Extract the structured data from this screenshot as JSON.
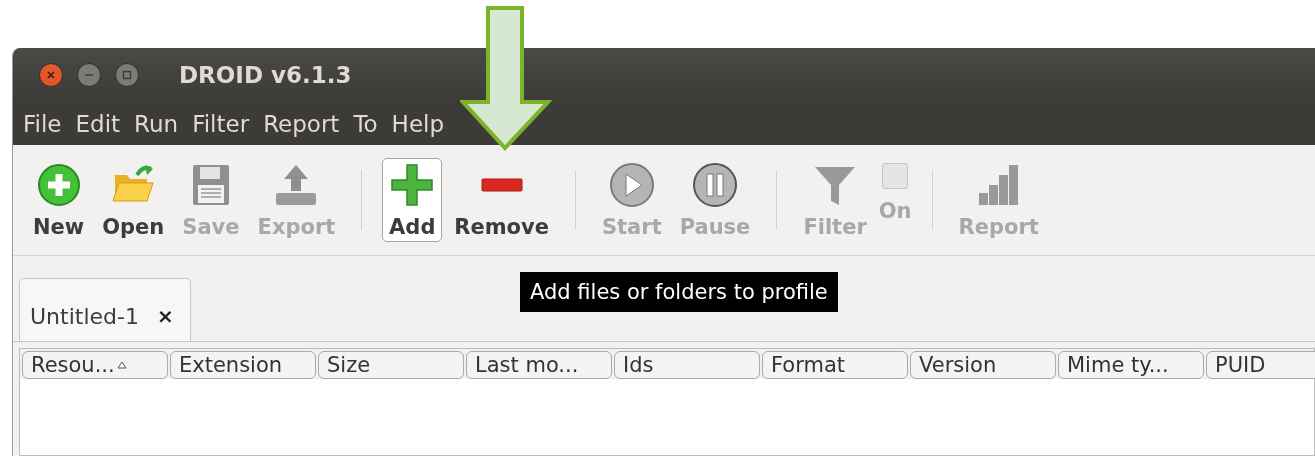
{
  "window": {
    "title": "DROID v6.1.3"
  },
  "menu": [
    {
      "label": "File"
    },
    {
      "label": "Edit"
    },
    {
      "label": "Run"
    },
    {
      "label": "Filter"
    },
    {
      "label": "Report"
    },
    {
      "label": "To"
    },
    {
      "label": "Help"
    }
  ],
  "toolbar": [
    {
      "kind": "button",
      "label": "New",
      "disabled": false,
      "hovered": false
    },
    {
      "kind": "button",
      "label": "Open",
      "disabled": false,
      "hovered": false
    },
    {
      "kind": "button",
      "label": "Save",
      "disabled": true,
      "hovered": false
    },
    {
      "kind": "button",
      "label": "Export",
      "disabled": true,
      "hovered": false
    },
    {
      "kind": "separator"
    },
    {
      "kind": "button",
      "label": "Add",
      "disabled": false,
      "hovered": true
    },
    {
      "kind": "button",
      "label": "Remove",
      "disabled": false,
      "hovered": false
    },
    {
      "kind": "separator"
    },
    {
      "kind": "button",
      "label": "Start",
      "disabled": true,
      "hovered": false
    },
    {
      "kind": "button",
      "label": "Pause",
      "disabled": true,
      "hovered": false
    },
    {
      "kind": "separator"
    },
    {
      "kind": "button",
      "label": "Filter",
      "disabled": true,
      "hovered": false
    },
    {
      "kind": "toggle",
      "label": "On",
      "disabled": true,
      "checked": false
    },
    {
      "kind": "separator"
    },
    {
      "kind": "button",
      "label": "Report",
      "disabled": true,
      "hovered": false
    }
  ],
  "tooltip": {
    "text": "Add files or folders to profile"
  },
  "tabs": [
    {
      "label": "Untitled-1",
      "close": "×",
      "selected": true
    }
  ],
  "table": {
    "columns": [
      {
        "label": "Resou...",
        "sorted": true
      },
      {
        "label": "Extension",
        "sorted": false
      },
      {
        "label": "Size",
        "sorted": false
      },
      {
        "label": "Last mo...",
        "sorted": false
      },
      {
        "label": "Ids",
        "sorted": false
      },
      {
        "label": "Format",
        "sorted": false
      },
      {
        "label": "Version",
        "sorted": false
      },
      {
        "label": "Mime ty...",
        "sorted": false
      },
      {
        "label": "PUID",
        "sorted": false
      }
    ]
  }
}
